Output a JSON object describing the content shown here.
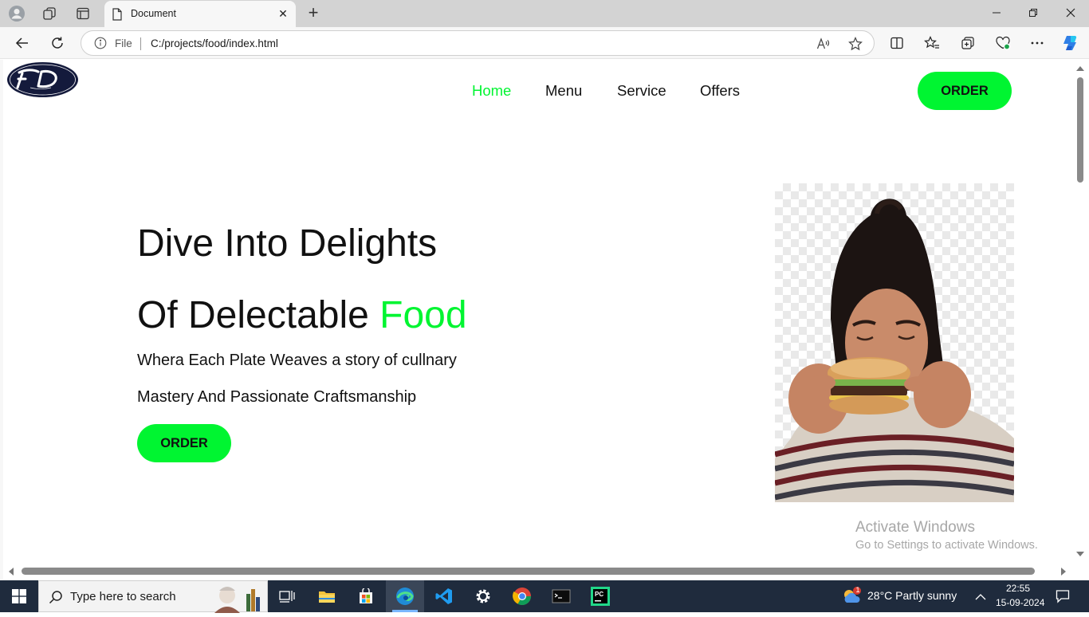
{
  "browser": {
    "tab_title": "Document",
    "address_prefix": "File",
    "url": "C:/projects/food/index.html"
  },
  "site": {
    "logo_text": "FD",
    "nav": [
      {
        "label": "Home",
        "active": true
      },
      {
        "label": "Menu",
        "active": false
      },
      {
        "label": "Service",
        "active": false
      },
      {
        "label": "Offers",
        "active": false
      }
    ],
    "order_label": "ORDER",
    "hero": {
      "line1": "Dive Into Delights",
      "line2_prefix": "Of Delectable ",
      "line2_accent": "Food",
      "sub1": "Whera Each Plate Weaves a story of cullnary",
      "sub2": "Mastery And Passionate Craftsmanship",
      "cta_label": "ORDER"
    },
    "accent_color": "#00f531"
  },
  "watermark": {
    "title": "Activate Windows",
    "subtitle": "Go to Settings to activate Windows."
  },
  "taskbar": {
    "search_placeholder": "Type here to search",
    "weather": "28°C  Partly sunny",
    "weather_badge": "1",
    "time": "22:55",
    "date": "15-09-2024"
  }
}
